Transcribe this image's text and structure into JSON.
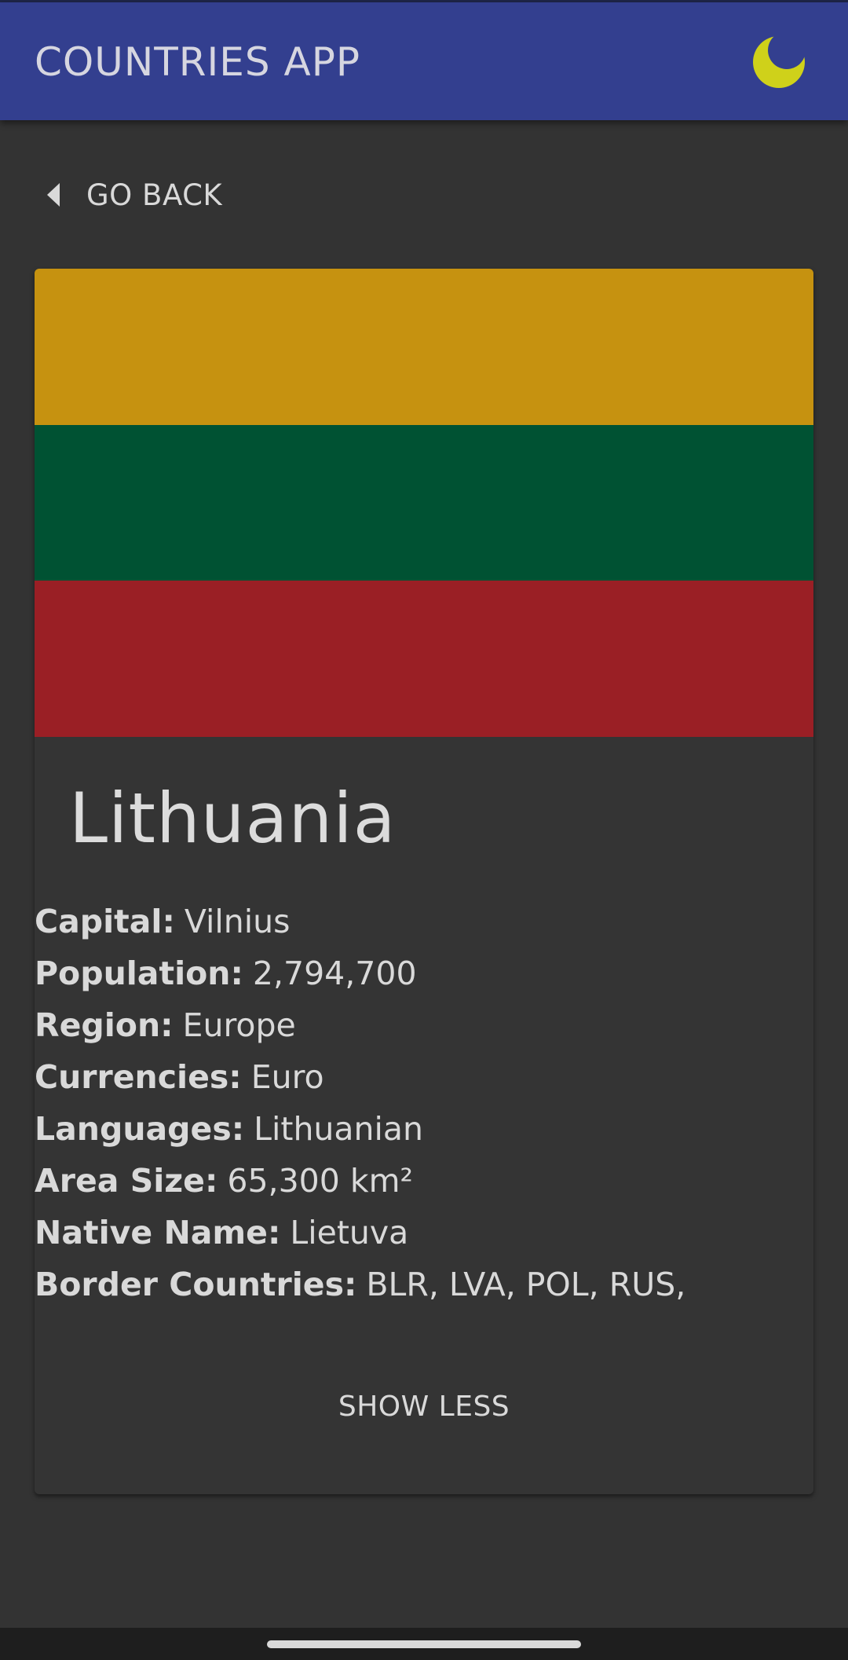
{
  "app_bar": {
    "title": "COUNTRIES APP",
    "theme_icon": "moon-icon",
    "theme_icon_color": "#cfd11a",
    "background": "#333f8f"
  },
  "back_button": {
    "icon": "caret-left-icon",
    "label": "GO BACK"
  },
  "country": {
    "name": "Lithuania",
    "flag": {
      "stripes": [
        "#c69210",
        "#005233",
        "#9a1f25"
      ]
    },
    "facts": [
      {
        "label": "Capital:",
        "value": "Vilnius"
      },
      {
        "label": "Population:",
        "value": "2,794,700"
      },
      {
        "label": "Region:",
        "value": "Europe"
      },
      {
        "label": "Currencies:",
        "value": "Euro"
      },
      {
        "label": "Languages:",
        "value": "Lithuanian"
      },
      {
        "label": "Area Size:",
        "value": "65,300 km²"
      },
      {
        "label": "Native Name:",
        "value": "Lietuva"
      },
      {
        "label": "Border Countries:",
        "value": "BLR, LVA, POL, RUS,"
      }
    ]
  },
  "show_less_label": "SHOW LESS"
}
